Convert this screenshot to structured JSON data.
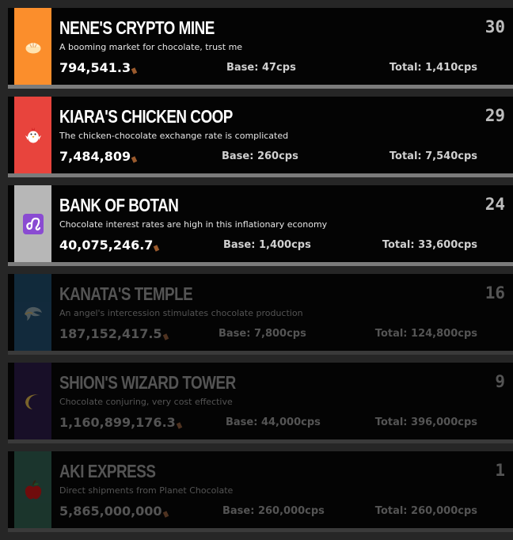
{
  "buildings": [
    {
      "name": "NENE'S CRYPTO MINE",
      "description": "A booming market for chocolate, trust me",
      "amount": "794,541.3",
      "base": "Base: 47cps",
      "total": "Total: 1,410cps",
      "count": "30",
      "locked": false,
      "color": "#fb8e2c",
      "icon": "bun-icon"
    },
    {
      "name": "KIARA'S CHICKEN COOP",
      "description": "The chicken-chocolate exchange rate is complicated",
      "amount": "7,484,809",
      "base": "Base: 260cps",
      "total": "Total: 7,540cps",
      "count": "29",
      "locked": false,
      "color": "#e8443d",
      "icon": "chicken-icon"
    },
    {
      "name": "BANK OF BOTAN",
      "description": "Chocolate interest rates are high in this inflationary economy",
      "amount": "40,075,246.7",
      "base": "Base: 1,400cps",
      "total": "Total: 33,600cps",
      "count": "24",
      "locked": false,
      "color": "#b7b7b7",
      "icon": "leo-icon"
    },
    {
      "name": "KANATA'S TEMPLE",
      "description": "An angel's intercession stimulates chocolate production",
      "amount": "187,152,417.5",
      "base": "Base: 7,800cps",
      "total": "Total: 124,800cps",
      "count": "16",
      "locked": true,
      "color": "#1e4a6a",
      "icon": "halo-wing-icon"
    },
    {
      "name": "SHION'S WIZARD TOWER",
      "description": "Chocolate conjuring, very cost effective",
      "amount": "1,160,899,176.3",
      "base": "Base: 44,000cps",
      "total": "Total: 396,000cps",
      "count": "9",
      "locked": true,
      "color": "#2a1846",
      "icon": "crescent-moon-icon"
    },
    {
      "name": "AKI EXPRESS",
      "description": "Direct shipments from Planet Chocolate",
      "amount": "5,865,000,000",
      "base": "Base: 260,000cps",
      "total": "Total: 260,000cps",
      "count": "1",
      "locked": true,
      "color": "#2f5e4f",
      "icon": "apple-icon"
    }
  ]
}
